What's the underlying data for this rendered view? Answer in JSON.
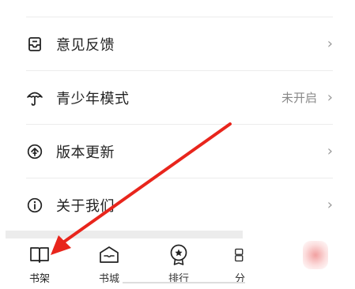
{
  "menu": {
    "items": [
      {
        "label": "意见反馈",
        "value": "",
        "icon": "feedback-tray-icon"
      },
      {
        "label": "青少年模式",
        "value": "未开启",
        "icon": "umbrella-icon"
      },
      {
        "label": "版本更新",
        "value": "",
        "icon": "upgrade-arrow-icon"
      },
      {
        "label": "关于我们",
        "value": "",
        "icon": "info-icon"
      }
    ],
    "chevron": "›"
  },
  "tabbar": {
    "tabs": [
      {
        "label": "书架",
        "icon": "book-icon"
      },
      {
        "label": "书城",
        "icon": "store-icon"
      },
      {
        "label": "排行",
        "icon": "ranking-medal-icon"
      },
      {
        "label": "分",
        "icon": "category-grid-icon"
      }
    ]
  },
  "colors": {
    "annotation_arrow": "#e8251c",
    "text_primary": "#222222",
    "text_secondary": "#888888"
  }
}
